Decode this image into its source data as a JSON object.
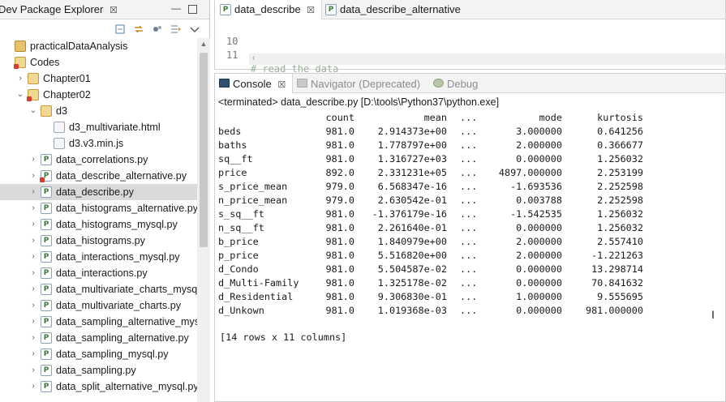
{
  "package_explorer": {
    "title": "Dev Package Explorer",
    "close_glyph": "☒",
    "toolbar_icons": [
      "collapse-all-icon",
      "link-with-editor-icon",
      "focus-icon",
      "filter-icon",
      "view-menu-icon"
    ],
    "items": [
      {
        "label": "practicalDataAnalysis",
        "indent": 0,
        "icon": "project-icon",
        "twisty": ""
      },
      {
        "label": "Codes",
        "indent": 0,
        "icon": "package-folder-icon",
        "twisty": "",
        "error": true
      },
      {
        "label": "Chapter01",
        "indent": 1,
        "icon": "package-icon",
        "twisty": "›"
      },
      {
        "label": "Chapter02",
        "indent": 1,
        "icon": "package-icon",
        "twisty": "⌄",
        "error": true
      },
      {
        "label": "d3",
        "indent": 2,
        "icon": "package-icon",
        "twisty": "⌄"
      },
      {
        "label": "d3_multivariate.html",
        "indent": 3,
        "icon": "file-icon",
        "twisty": ""
      },
      {
        "label": "d3.v3.min.js",
        "indent": 3,
        "icon": "file-icon",
        "twisty": ""
      },
      {
        "label": "data_correlations.py",
        "indent": 2,
        "icon": "python-file-icon",
        "twisty": "›"
      },
      {
        "label": "data_describe_alternative.py",
        "indent": 2,
        "icon": "python-file-icon",
        "twisty": "›",
        "error": true
      },
      {
        "label": "data_describe.py",
        "indent": 2,
        "icon": "python-file-icon",
        "twisty": "›",
        "selected": true
      },
      {
        "label": "data_histograms_alternative.py",
        "indent": 2,
        "icon": "python-file-icon",
        "twisty": "›"
      },
      {
        "label": "data_histograms_mysql.py",
        "indent": 2,
        "icon": "python-file-icon",
        "twisty": "›"
      },
      {
        "label": "data_histograms.py",
        "indent": 2,
        "icon": "python-file-icon",
        "twisty": "›"
      },
      {
        "label": "data_interactions_mysql.py",
        "indent": 2,
        "icon": "python-file-icon",
        "twisty": "›"
      },
      {
        "label": "data_interactions.py",
        "indent": 2,
        "icon": "python-file-icon",
        "twisty": "›"
      },
      {
        "label": "data_multivariate_charts_mysql.py",
        "indent": 2,
        "icon": "python-file-icon",
        "twisty": "›"
      },
      {
        "label": "data_multivariate_charts.py",
        "indent": 2,
        "icon": "python-file-icon",
        "twisty": "›"
      },
      {
        "label": "data_sampling_alternative_mysql.",
        "indent": 2,
        "icon": "python-file-icon",
        "twisty": "›"
      },
      {
        "label": "data_sampling_alternative.py",
        "indent": 2,
        "icon": "python-file-icon",
        "twisty": "›"
      },
      {
        "label": "data_sampling_mysql.py",
        "indent": 2,
        "icon": "python-file-icon",
        "twisty": "›"
      },
      {
        "label": "data_sampling.py",
        "indent": 2,
        "icon": "python-file-icon",
        "twisty": "›"
      },
      {
        "label": "data_split_alternative_mysql.py",
        "indent": 2,
        "icon": "python-file-icon",
        "twisty": "›"
      }
    ]
  },
  "editor": {
    "tabs": [
      {
        "label": "data_describe",
        "active": true,
        "close_glyph": "☒"
      },
      {
        "label": "data_describe_alternative",
        "active": false
      }
    ],
    "lines": [
      {
        "number": "10",
        "text": ""
      },
      {
        "number": "11",
        "text": "# read the data"
      }
    ],
    "hscroll_arrow": "‹"
  },
  "console": {
    "tabs": [
      {
        "label": "Console",
        "active": true,
        "close_glyph": "☒",
        "icon": "console-icon"
      },
      {
        "label": "Navigator (Deprecated)",
        "active": false,
        "icon": "navigator-icon"
      },
      {
        "label": "Debug",
        "active": false,
        "icon": "debug-icon"
      }
    ],
    "terminated": "<terminated> data_describe.py [D:\\tools\\Python37\\python.exe]",
    "header": {
      "count": "count",
      "mean": "mean",
      "dots": "...",
      "mode": "mode",
      "kurtosis": "kurtosis"
    },
    "rows": [
      {
        "name": "beds",
        "count": "981.0",
        "mean": "2.914373e+00",
        "dots": "...",
        "mode": "3.000000",
        "kurtosis": "0.641256"
      },
      {
        "name": "baths",
        "count": "981.0",
        "mean": "1.778797e+00",
        "dots": "...",
        "mode": "2.000000",
        "kurtosis": "0.366677"
      },
      {
        "name": "sq__ft",
        "count": "981.0",
        "mean": "1.316727e+03",
        "dots": "...",
        "mode": "0.000000",
        "kurtosis": "1.256032"
      },
      {
        "name": "price",
        "count": "892.0",
        "mean": "2.331231e+05",
        "dots": "...",
        "mode": "4897.000000",
        "kurtosis": "2.253199"
      },
      {
        "name": "s_price_mean",
        "count": "979.0",
        "mean": "6.568347e-16",
        "dots": "...",
        "mode": "-1.693536",
        "kurtosis": "2.252598"
      },
      {
        "name": "n_price_mean",
        "count": "979.0",
        "mean": "2.630542e-01",
        "dots": "...",
        "mode": "0.003788",
        "kurtosis": "2.252598"
      },
      {
        "name": "s_sq__ft",
        "count": "981.0",
        "mean": "-1.376179e-16",
        "dots": "...",
        "mode": "-1.542535",
        "kurtosis": "1.256032"
      },
      {
        "name": "n_sq__ft",
        "count": "981.0",
        "mean": "2.261640e-01",
        "dots": "...",
        "mode": "0.000000",
        "kurtosis": "1.256032"
      },
      {
        "name": "b_price",
        "count": "981.0",
        "mean": "1.840979e+00",
        "dots": "...",
        "mode": "2.000000",
        "kurtosis": "2.557410"
      },
      {
        "name": "p_price",
        "count": "981.0",
        "mean": "5.516820e+00",
        "dots": "...",
        "mode": "2.000000",
        "kurtosis": "-1.221263"
      },
      {
        "name": "d_Condo",
        "count": "981.0",
        "mean": "5.504587e-02",
        "dots": "...",
        "mode": "0.000000",
        "kurtosis": "13.298714"
      },
      {
        "name": "d_Multi-Family",
        "count": "981.0",
        "mean": "1.325178e-02",
        "dots": "...",
        "mode": "0.000000",
        "kurtosis": "70.841632"
      },
      {
        "name": "d_Residential",
        "count": "981.0",
        "mean": "9.306830e-01",
        "dots": "...",
        "mode": "1.000000",
        "kurtosis": "9.555695"
      },
      {
        "name": "d_Unkown",
        "count": "981.0",
        "mean": "1.019368e-03",
        "dots": "...",
        "mode": "0.000000",
        "kurtosis": "981.000000"
      }
    ],
    "summary": "[14 rows x 11 columns]"
  },
  "colors": {
    "selection": "#dadada",
    "tab_bar": "#f3f3f3",
    "comment": "#9cb09c",
    "python_icon": "#3b7a37"
  }
}
